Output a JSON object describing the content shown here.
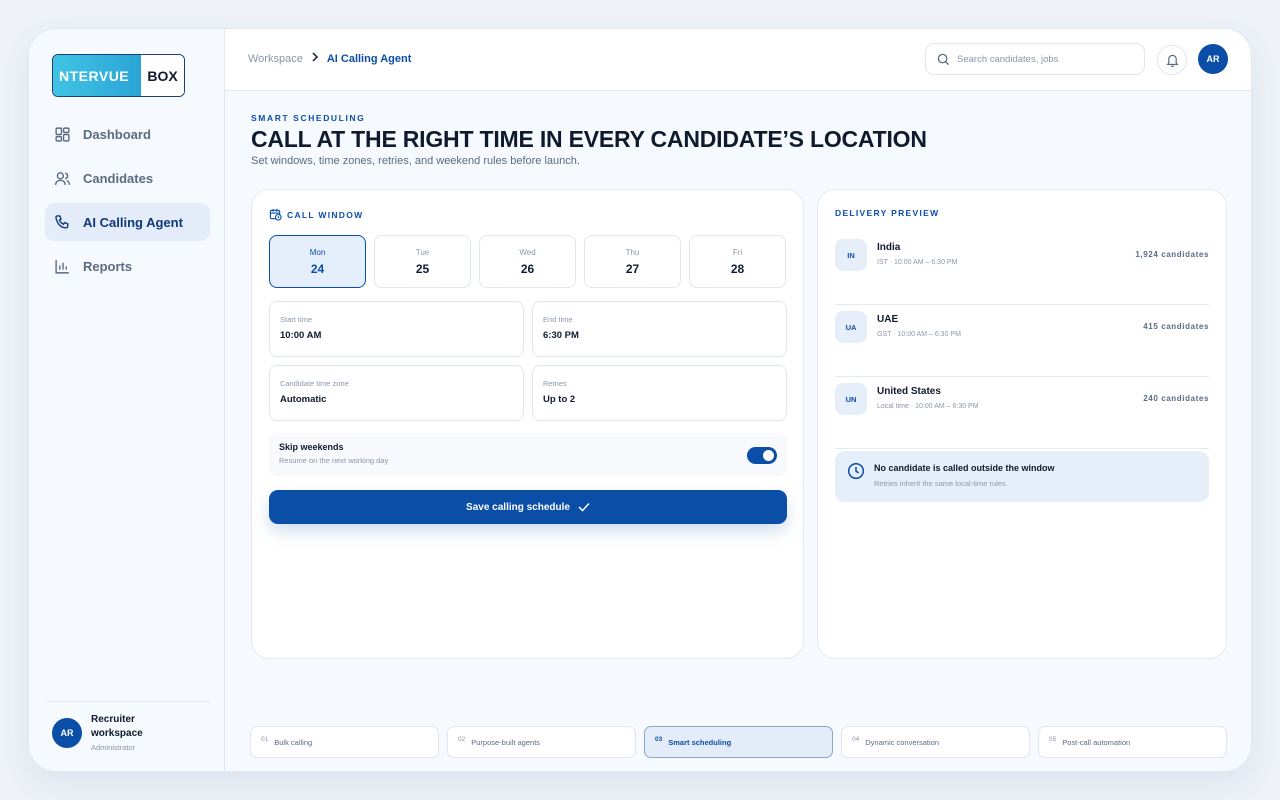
{
  "brand": {
    "logo_left": "NTERVUE",
    "logo_right": "BOX",
    "accent": "#0b4ea8"
  },
  "sidebar": {
    "items": [
      {
        "label": "Dashboard",
        "icon": "dashboard-icon"
      },
      {
        "label": "Candidates",
        "icon": "users-icon"
      },
      {
        "label": "AI Calling Agent",
        "icon": "phone-icon",
        "active": true
      },
      {
        "label": "Reports",
        "icon": "bar-chart-icon"
      }
    ],
    "user": {
      "initials": "AR",
      "name": "Recruiter workspace",
      "role": "Administrator"
    }
  },
  "topbar": {
    "breadcrumb": {
      "parent": "Workspace",
      "current": "AI Calling Agent"
    },
    "search_placeholder": "Search candidates, jobs",
    "avatar_initials": "AR"
  },
  "header": {
    "eyebrow": "SMART SCHEDULING",
    "title": "CALL AT THE RIGHT TIME IN EVERY CANDIDATE’S LOCATION",
    "subtitle": "Set windows, time zones, retries, and weekend rules before launch."
  },
  "call_window": {
    "title": "CALL WINDOW",
    "days": [
      {
        "name": "Mon",
        "date": "24",
        "selected": true
      },
      {
        "name": "Tue",
        "date": "25"
      },
      {
        "name": "Wed",
        "date": "26"
      },
      {
        "name": "Thu",
        "date": "27"
      },
      {
        "name": "Fri",
        "date": "28"
      }
    ],
    "fields": [
      {
        "label": "Start time",
        "value": "10:00 AM"
      },
      {
        "label": "End time",
        "value": "6:30 PM"
      },
      {
        "label": "Candidate time zone",
        "value": "Automatic"
      },
      {
        "label": "Retries",
        "value": "Up to 2"
      }
    ],
    "weekend": {
      "label": "Skip weekends",
      "sub": "Resume on the next working day",
      "enabled": true
    },
    "save_label": "Save calling schedule"
  },
  "preview": {
    "title": "DELIVERY PREVIEW",
    "regions": [
      {
        "code": "IN",
        "name": "India",
        "time": "IST · 10:00 AM – 6:30 PM",
        "count": "1,924 candidates"
      },
      {
        "code": "UA",
        "name": "UAE",
        "time": "GST · 10:00 AM – 6:30 PM",
        "count": "415 candidates"
      },
      {
        "code": "UN",
        "name": "United States",
        "time": "Local time · 10:00 AM – 6:30 PM",
        "count": "240 candidates"
      }
    ],
    "notice": {
      "title": "No candidate is called outside the window",
      "sub": "Retries inherit the same local-time rules."
    }
  },
  "steps": [
    {
      "num": "01",
      "label": "Bulk calling"
    },
    {
      "num": "02",
      "label": "Purpose-built agents"
    },
    {
      "num": "03",
      "label": "Smart scheduling",
      "active": true
    },
    {
      "num": "04",
      "label": "Dynamic conversation"
    },
    {
      "num": "05",
      "label": "Post-call automation"
    }
  ]
}
